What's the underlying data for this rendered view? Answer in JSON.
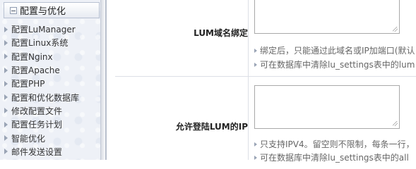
{
  "sidebar": {
    "header": "配置与优化",
    "items": [
      {
        "label": "配置LuManager"
      },
      {
        "label": "配置Linux系统"
      },
      {
        "label": "配置Nginx"
      },
      {
        "label": "配置Apache"
      },
      {
        "label": "配置PHP"
      },
      {
        "label": "配置和优化数据库"
      },
      {
        "label": "修改配置文件"
      },
      {
        "label": "配置任务计划"
      },
      {
        "label": "智能优化"
      },
      {
        "label": "邮件发送设置"
      }
    ]
  },
  "form": {
    "rows": [
      {
        "label": "LUM域名绑定",
        "value": "",
        "hints": [
          "绑定后，只能通过此域名或IP加端口(默认",
          "可在数据库中清除lu_settings表中的lum"
        ]
      },
      {
        "label": "允许登陆LUM的IP",
        "value": "",
        "hints": [
          "只支持IPV4。留空则不限制，每条一行，",
          "可在数据库中清除lu_settings表中的all"
        ]
      }
    ]
  }
}
